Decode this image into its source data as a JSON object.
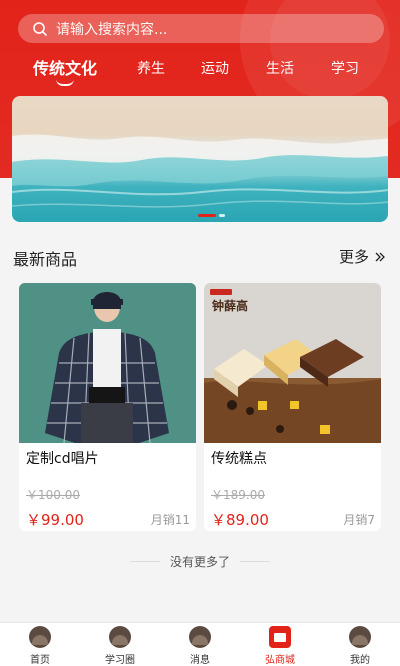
{
  "search": {
    "placeholder": "请输入搜索内容..."
  },
  "tabs": [
    {
      "label": "传统文化",
      "active": true
    },
    {
      "label": "养生",
      "active": false
    },
    {
      "label": "运动",
      "active": false
    },
    {
      "label": "生活",
      "active": false
    },
    {
      "label": "学习",
      "active": false
    }
  ],
  "section": {
    "title": "最新商品",
    "more_label": "更多"
  },
  "products": [
    {
      "name": "定制cd唱片",
      "old_price": "￥100.00",
      "price": "￥99.00",
      "sold": "月销11"
    },
    {
      "name": "传统糕点",
      "old_price": "￥189.00",
      "price": "￥89.00",
      "sold": "月销7",
      "brand_text": "钟薛高"
    }
  ],
  "no_more": "没有更多了",
  "tabbar": [
    {
      "label": "首页",
      "icon": "home-icon"
    },
    {
      "label": "学习圈",
      "icon": "study-circle-icon"
    },
    {
      "label": "消息",
      "icon": "message-icon"
    },
    {
      "label": "弘商城",
      "icon": "mall-icon",
      "active": true
    },
    {
      "label": "我的",
      "icon": "profile-icon"
    }
  ],
  "colors": {
    "accent": "#e2231a",
    "background": "#f4f4f4"
  }
}
